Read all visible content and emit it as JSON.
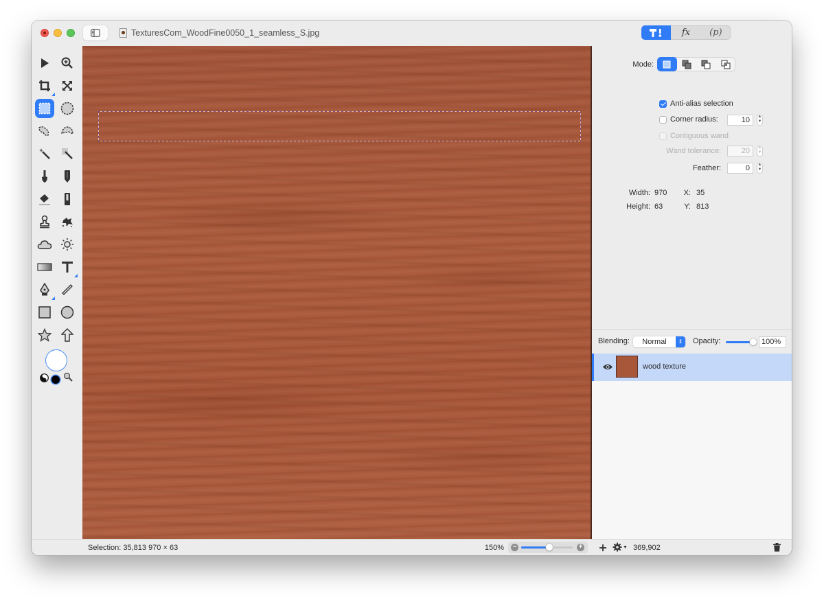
{
  "window": {
    "document_title": "TexturesCom_WoodFine0050_1_seamless_S.jpg",
    "top_segments": [
      {
        "name": "tools-icon",
        "label": "T⁝",
        "active": true
      },
      {
        "name": "effects",
        "label": "fx",
        "active": false
      },
      {
        "name": "presets",
        "label": "(p)",
        "active": false
      }
    ]
  },
  "toolbox": {
    "tools": [
      {
        "name": "arrow-tool",
        "glyph": "▶"
      },
      {
        "name": "zoom-tool",
        "glyph": "🔍"
      },
      {
        "name": "crop-tool",
        "glyph": "⌗"
      },
      {
        "name": "transform-tool",
        "glyph": "⤧"
      },
      {
        "name": "rectangle-select-tool",
        "glyph": "⬚",
        "active": true
      },
      {
        "name": "ellipse-select-tool",
        "glyph": "◌"
      },
      {
        "name": "lasso-tool",
        "glyph": "◔"
      },
      {
        "name": "polygon-lasso-tool",
        "glyph": "◓"
      },
      {
        "name": "magic-wand-tool",
        "glyph": "✦"
      },
      {
        "name": "color-wand-tool",
        "glyph": "✧"
      },
      {
        "name": "brush-tool",
        "glyph": "🖌"
      },
      {
        "name": "pencil-tool",
        "glyph": "✎"
      },
      {
        "name": "eraser-tool",
        "glyph": "⌫"
      },
      {
        "name": "fill-tool",
        "glyph": "▮"
      },
      {
        "name": "clone-stamp-tool",
        "glyph": "⚲"
      },
      {
        "name": "smudge-tool",
        "glyph": "✺"
      },
      {
        "name": "cloud-tool",
        "glyph": "☁"
      },
      {
        "name": "light-tool",
        "glyph": "☼"
      },
      {
        "name": "gradient-tool",
        "glyph": "▭"
      },
      {
        "name": "text-tool",
        "glyph": "T"
      },
      {
        "name": "pen-tool",
        "glyph": "✒"
      },
      {
        "name": "line-tool",
        "glyph": "⟋"
      },
      {
        "name": "rectangle-shape-tool",
        "glyph": "■"
      },
      {
        "name": "ellipse-shape-tool",
        "glyph": "●"
      },
      {
        "name": "star-tool",
        "glyph": "☆"
      },
      {
        "name": "arrow-shape-tool",
        "glyph": "⇧"
      }
    ],
    "fill_color": "#ffffff",
    "stroke_color": "#000000"
  },
  "inspector": {
    "mode_label": "Mode:",
    "modes": [
      "new-selection",
      "add-selection",
      "subtract-selection",
      "intersect-selection"
    ],
    "anti_alias_label": "Anti-alias selection",
    "anti_alias_checked": true,
    "corner_radius_label": "Corner radius:",
    "corner_radius_checked": false,
    "corner_radius_value": "10",
    "contiguous_wand_label": "Contiguous wand",
    "wand_tolerance_label": "Wand tolerance:",
    "wand_tolerance_value": "20",
    "feather_label": "Feather:",
    "feather_value": "0",
    "width_label": "Width:",
    "width_value": "970",
    "height_label": "Height:",
    "height_value": "63",
    "x_label": "X:",
    "x_value": "35",
    "y_label": "Y:",
    "y_value": "813"
  },
  "layers": {
    "blending_label": "Blending:",
    "blending_value": "Normal",
    "opacity_label": "Opacity:",
    "opacity_value": "100%",
    "opacity_fraction": 1.0,
    "items": [
      {
        "name": "wood texture",
        "visible": true,
        "selected": true
      }
    ]
  },
  "statusbar": {
    "selection_text": "Selection: 35,813 970 × 63",
    "zoom_text": "150%",
    "zoom_slider_fraction": 0.55,
    "coords_text": "369,902"
  },
  "colors": {
    "accent": "#2f7cf6",
    "wood": "#a9573a",
    "layer_selected_bg": "#c4d8fa"
  }
}
